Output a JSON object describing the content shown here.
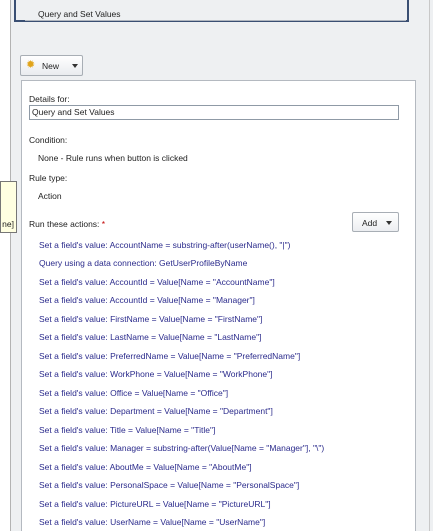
{
  "rules_list": {
    "selected_rule": "Query and Set Values"
  },
  "toolbar": {
    "new_label": "New"
  },
  "details": {
    "details_for_label": "Details for:",
    "rule_name_value": "Query and Set Values",
    "condition_label": "Condition:",
    "condition_value": "None - Rule runs when button is clicked",
    "rule_type_label": "Rule type:",
    "rule_type_value": "Action",
    "run_actions_label": "Run these actions:",
    "required_marker": "*",
    "add_label": "Add"
  },
  "actions": [
    "Set a field's value: AccountName = substring-after(userName(), \"|\")",
    "Query using a data connection: GetUserProfileByName",
    "Set a field's value: AccountId = Value[Name = \"AccountName\"]",
    "Set a field's value: AccountId = Value[Name = \"Manager\"]",
    "Set a field's value: FirstName = Value[Name = \"FirstName\"]",
    "Set a field's value: LastName = Value[Name = \"LastName\"]",
    "Set a field's value: PreferredName = Value[Name = \"PreferredName\"]",
    "Set a field's value: WorkPhone = Value[Name = \"WorkPhone\"]",
    "Set a field's value: Office = Value[Name = \"Office\"]",
    "Set a field's value: Department = Value[Name = \"Department\"]",
    "Set a field's value: Title = Value[Name = \"Title\"]",
    "Set a field's value: Manager = substring-after(Value[Name = \"Manager\"], \"\\\")",
    "Set a field's value: AboutMe = Value[Name = \"AboutMe\"]",
    "Set a field's value: PersonalSpace = Value[Name = \"PersonalSpace\"]",
    "Set a field's value: PictureURL = Value[Name = \"PictureURL\"]",
    "Set a field's value: UserName = Value[Name = \"UserName\"]"
  ],
  "tooltip": {
    "text": "ne]"
  },
  "icons": {
    "new": "sparkle-icon",
    "dropdown": "chevron-down-icon"
  }
}
